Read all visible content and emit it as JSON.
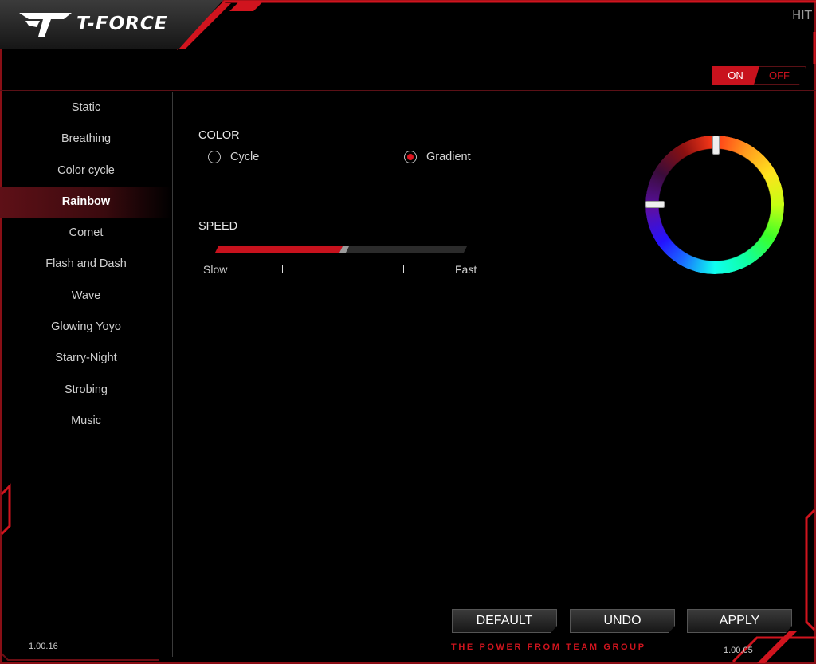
{
  "app": {
    "brand": "T-FORCE",
    "window_control_glyph": "HIT",
    "tagline": "THE POWER FROM TEAM GROUP",
    "version_left": "1.00.16",
    "version_right": "1.00.05",
    "accent_color": "#c8121d"
  },
  "power_toggle": {
    "on_label": "ON",
    "off_label": "OFF",
    "state": "ON"
  },
  "sidebar": {
    "selected": "Rainbow",
    "items": [
      {
        "label": "Static"
      },
      {
        "label": "Breathing"
      },
      {
        "label": "Color cycle"
      },
      {
        "label": "Rainbow"
      },
      {
        "label": "Comet"
      },
      {
        "label": "Flash and Dash"
      },
      {
        "label": "Wave"
      },
      {
        "label": "Glowing Yoyo"
      },
      {
        "label": "Starry-Night"
      },
      {
        "label": "Strobing"
      },
      {
        "label": "Music"
      }
    ]
  },
  "color": {
    "heading": "COLOR",
    "options": [
      {
        "label": "Cycle",
        "selected": false
      },
      {
        "label": "Gradient",
        "selected": true
      }
    ],
    "wheel_icon": "color-wheel"
  },
  "speed": {
    "heading": "SPEED",
    "min_label": "Slow",
    "max_label": "Fast",
    "level_fraction": 0.5
  },
  "buttons": {
    "default_label": "DEFAULT",
    "undo_label": "UNDO",
    "apply_label": "APPLY"
  }
}
